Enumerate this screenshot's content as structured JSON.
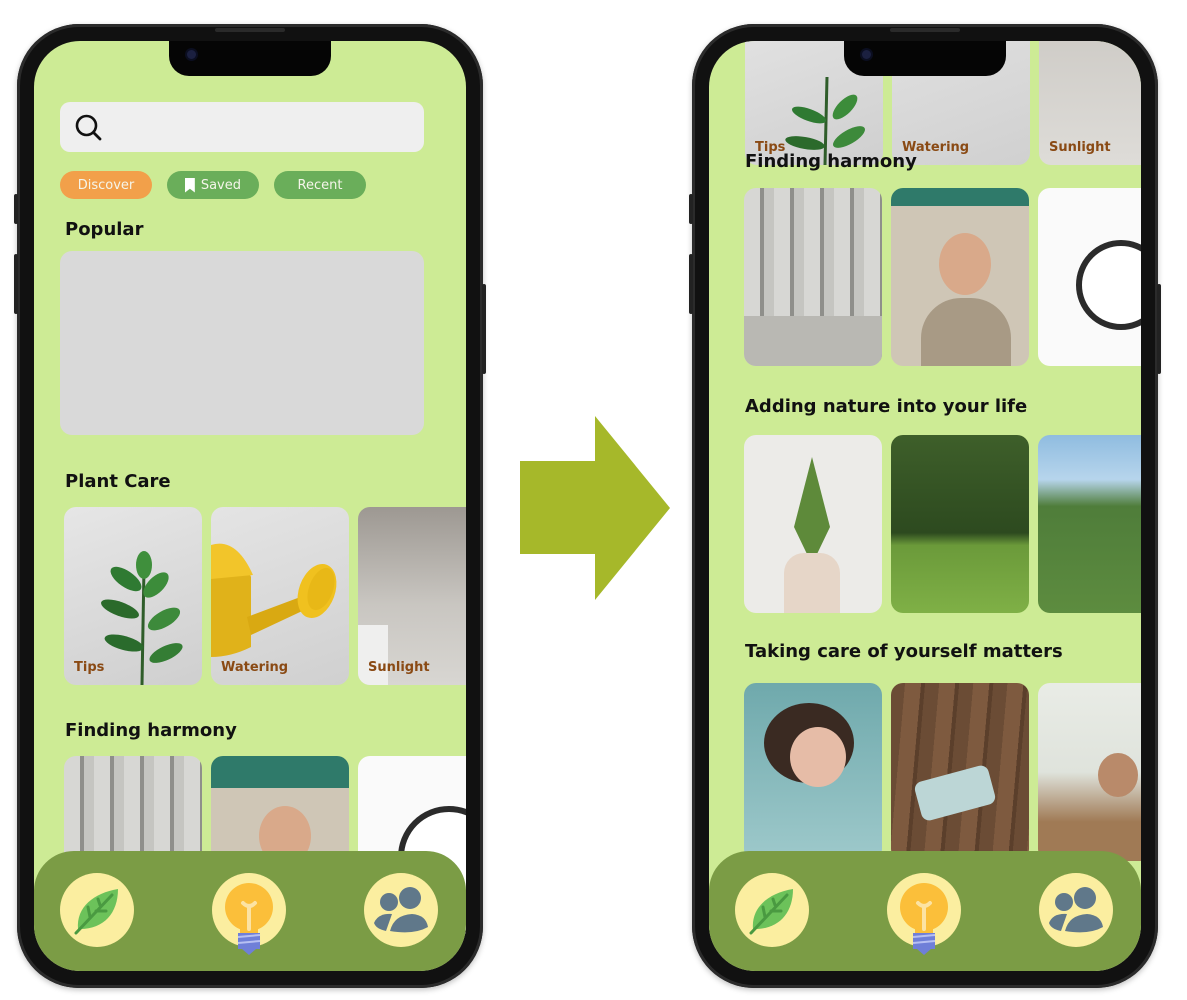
{
  "left_screen": {
    "search": {
      "placeholder": "",
      "icon": "search-icon"
    },
    "chips": [
      {
        "label": "Discover",
        "active": true,
        "color": "#f2a04a"
      },
      {
        "label": "Saved",
        "icon": "bookmark-icon",
        "color": "#6aae5a"
      },
      {
        "label": "Recent",
        "color": "#6aae5a"
      }
    ],
    "popular_title": "Popular",
    "plant_care_title": "Plant Care",
    "plant_care_cards": [
      {
        "label": "Tips",
        "image": "plant-sprig"
      },
      {
        "label": "Watering",
        "image": "yellow-watering-can"
      },
      {
        "label": "Sunlight",
        "image": "sunlit-wall"
      }
    ],
    "harmony_title": "Finding harmony",
    "harmony_cards": [
      {
        "image": "person-running-columns"
      },
      {
        "image": "woman-sunglasses-peace-sign"
      },
      {
        "image": "alarm-clock"
      }
    ]
  },
  "right_screen": {
    "plant_care_cards": [
      {
        "label": "Tips"
      },
      {
        "label": "Watering"
      },
      {
        "label": "Sunlight"
      }
    ],
    "harmony_title": "Finding harmony",
    "harmony_cards": [
      {
        "image": "person-running-columns"
      },
      {
        "image": "woman-sunglasses-peace-sign"
      },
      {
        "image": "alarm-clock"
      }
    ],
    "nature_title": "Adding nature into your life",
    "nature_cards": [
      {
        "image": "hand-holding-sapling"
      },
      {
        "image": "park-trees-grass"
      },
      {
        "image": "people-camping"
      }
    ],
    "selfcare_title": "Taking care of yourself matters",
    "selfcare_cards": [
      {
        "image": "woman-sleeping"
      },
      {
        "image": "face-mask-on-table"
      },
      {
        "image": "woman-laptop-kitchen"
      }
    ]
  },
  "bottom_nav": [
    {
      "icon": "leaf-icon"
    },
    {
      "icon": "lightbulb-icon"
    },
    {
      "icon": "community-icon"
    }
  ],
  "colors": {
    "screen_bg": "#cdeb95",
    "nav_bg": "#7b9c45",
    "nav_button_bg": "#fbeea0",
    "arrow": "#a6b82a",
    "card_label": "#8a4a14"
  }
}
